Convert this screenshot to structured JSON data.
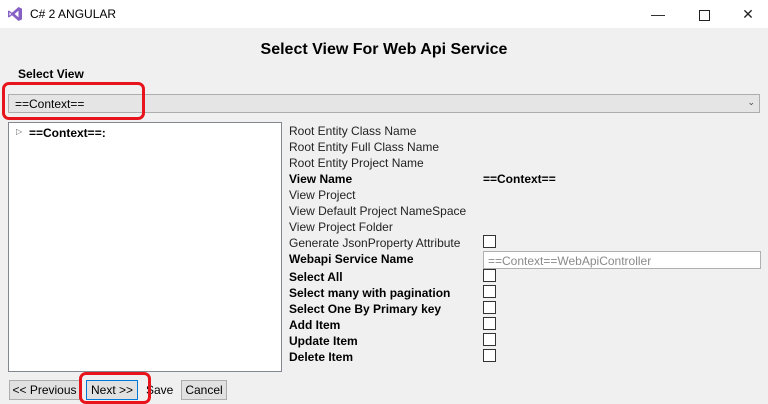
{
  "window": {
    "title": "C# 2 ANGULAR",
    "controls": {
      "minimize": "—",
      "close": "✕"
    },
    "accent_color": "#865fc5"
  },
  "dialog": {
    "heading": "Select View For Web Api Service",
    "select_view_label": "Select View",
    "selected_view": "==Context==",
    "combo_arrow": "⌄"
  },
  "tree": {
    "expander": "▷",
    "items": [
      {
        "label": "==Context==:"
      }
    ]
  },
  "properties": {
    "root_entity_class_name": "Root Entity Class Name",
    "root_entity_full_class_name": "Root Entity Full Class Name",
    "root_entity_project_name": "Root Entity Project Name",
    "view_name": {
      "label": "View Name",
      "value": "==Context=="
    },
    "view_project": "View Project",
    "view_default_project_namespace": "View Default Project NameSpace",
    "view_project_folder": "View Project Folder",
    "generate_json_property": {
      "label": "Generate JsonProperty Attribute",
      "checked": false
    },
    "webapi_service_name": {
      "label": "Webapi Service Name",
      "value": "==Context==WebApiController"
    },
    "select_all": {
      "label": "Select All",
      "checked": false
    },
    "select_many_pagination": {
      "label": "Select many with pagination",
      "checked": false
    },
    "select_one_primary_key": {
      "label": "Select One By Primary key",
      "checked": false
    },
    "add_item": {
      "label": "Add Item",
      "checked": false
    },
    "update_item": {
      "label": "Update Item",
      "checked": false
    },
    "delete_item": {
      "label": "Delete Item",
      "checked": false
    }
  },
  "buttons": {
    "previous": "<< Previous",
    "next": "Next >>",
    "save": "Save",
    "cancel": "Cancel"
  },
  "annotation_color": "#e8141c"
}
